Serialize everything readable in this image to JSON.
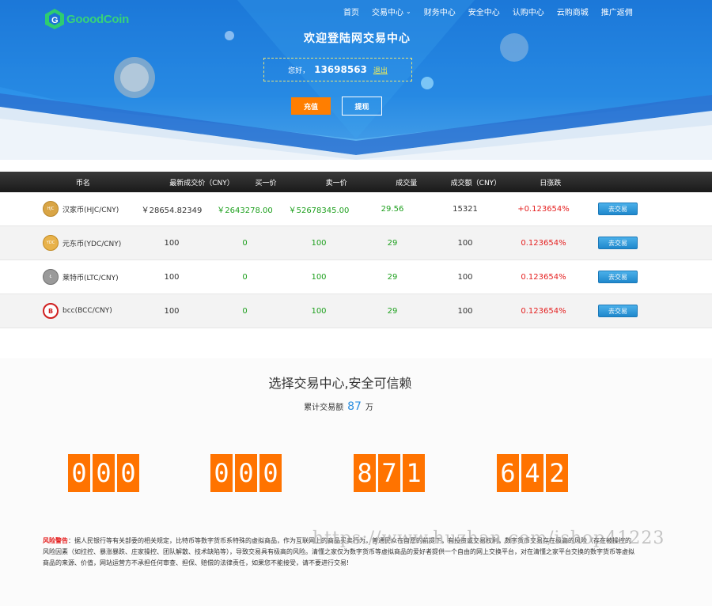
{
  "header": {
    "logo_text": "GooodCoin",
    "nav": [
      {
        "label": "首页",
        "has_dropdown": false
      },
      {
        "label": "交易中心",
        "has_dropdown": true
      },
      {
        "label": "财务中心",
        "has_dropdown": false
      },
      {
        "label": "安全中心",
        "has_dropdown": false
      },
      {
        "label": "认购中心",
        "has_dropdown": false
      },
      {
        "label": "云购商城",
        "has_dropdown": false
      },
      {
        "label": "推广返佣",
        "has_dropdown": false
      }
    ],
    "welcome": "欢迎登陆网交易中心",
    "greeting": "您好，",
    "user_id": "13698563",
    "logout": "退出",
    "recharge": "充值",
    "withdraw": "提现"
  },
  "market": {
    "columns": [
      "币名",
      "最新成交价（CNY）",
      "买一价",
      "卖一价",
      "成交量",
      "成交额（CNY）",
      "日涨跌"
    ],
    "rows": [
      {
        "icon": "hjc-coin-icon",
        "name": "汉家币(HJC/CNY)",
        "price": "￥28654.82349",
        "bid": "￥2643278.00",
        "ask": "￥52678345.00",
        "volume": "29.56",
        "amount": "15321",
        "change": "+0.123654%",
        "action": "去交易"
      },
      {
        "icon": "ydc-coin-icon",
        "name": "元东币(YDC/CNY)",
        "price": "100",
        "bid": "0",
        "ask": "100",
        "volume": "29",
        "amount": "100",
        "change": "0.123654%",
        "action": "去交易"
      },
      {
        "icon": "ltc-coin-icon",
        "name": "莱特币(LTC/CNY)",
        "price": "100",
        "bid": "0",
        "ask": "100",
        "volume": "29",
        "amount": "100",
        "change": "0.123654%",
        "action": "去交易"
      },
      {
        "icon": "bcc-coin-icon",
        "name": "bcc(BCC/CNY)",
        "price": "100",
        "bid": "0",
        "ask": "100",
        "volume": "29",
        "amount": "100",
        "change": "0.123654%",
        "action": "去交易"
      }
    ]
  },
  "stats": {
    "title": "选择交易中心,安全可信赖",
    "total_label": "累计交易额",
    "total_value": "87",
    "total_unit": "万",
    "counter_groups": [
      [
        "0",
        "0",
        "0"
      ],
      [
        "0",
        "0",
        "0"
      ],
      [
        "8",
        "7",
        "1"
      ],
      [
        "6",
        "4",
        "2"
      ]
    ]
  },
  "warning": {
    "label": "风险警告",
    "text": "：据人民银行等有关部委的相关规定，比特币等数字货币系特殊的虚拟商品，作为互联网上的商品买卖行为，普通民众在自愿的前提下，有投资或交易权利，数字货币交易存在极高的风险（存在被操控的风险因素（如拉控、暴涨暴跌、庄家操控、团队解散、技术缺陷等），导致交易具有极高的风险。清懂之家仅为数字货币等虚拟商品的爱好者提供一个自由的网上交换平台，对在清懂之家平台交换的数字货币等虚拟商品的来源、价值，网站运营方不承担任何审查、担保、赔偿的法律责任，如果您不能接受，请不要进行交易!"
  },
  "watermark": "https://www.huzhan.com/ishop41223",
  "colors": {
    "accent_orange": "#ff7300",
    "buy_green": "#1ea01e",
    "change_red": "#e52020",
    "trade_blue": "#2b8ee0"
  }
}
